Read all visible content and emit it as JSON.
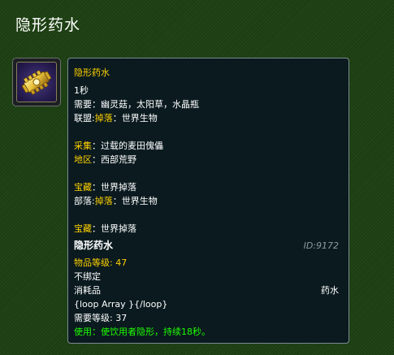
{
  "page": {
    "title": "隐形药水"
  },
  "icon": {
    "name": "gear-icon",
    "accent": "#e8c23a"
  },
  "colors": {
    "background": "#1d3d12",
    "tooltip_bg": "#0a1a1f",
    "yellow": "#ffd100",
    "green": "#1eff00",
    "white": "#ffffff",
    "id_gray": "#8a9aa0"
  },
  "tooltip": {
    "header_name": "隐形药水",
    "cast_time": "1秒",
    "requires_label": "需要：",
    "requires_value": "幽灵菇，太阳草，水晶瓶",
    "alliance_label": "联盟:",
    "alliance_drop": "掉落",
    "alliance_sep": "：",
    "alliance_value": "世界生物",
    "gather_label": "采集",
    "gather_sep": "：",
    "gather_value": "过载的麦田傀儡",
    "zone_label": "地区",
    "zone_sep": "：",
    "zone_value": "西部荒野",
    "treasure1_label": "宝藏",
    "treasure1_sep": "：",
    "treasure1_value": "世界掉落",
    "horde_label": "部落:",
    "horde_drop": "掉落",
    "horde_sep": "：",
    "horde_value": "世界生物",
    "treasure2_label": "宝藏",
    "treasure2_sep": "：",
    "treasure2_value": "世界掉落",
    "item_name": "隐形药水",
    "item_id": "ID:9172",
    "item_level": "物品等级: 47",
    "binding": "不绑定",
    "consumable": "消耗品",
    "item_type": "药水",
    "loop": "{loop Array }{/loop}",
    "required_level": "需要等级: 37",
    "use_text": "使用：使饮用者隐形，持续18秒。"
  }
}
